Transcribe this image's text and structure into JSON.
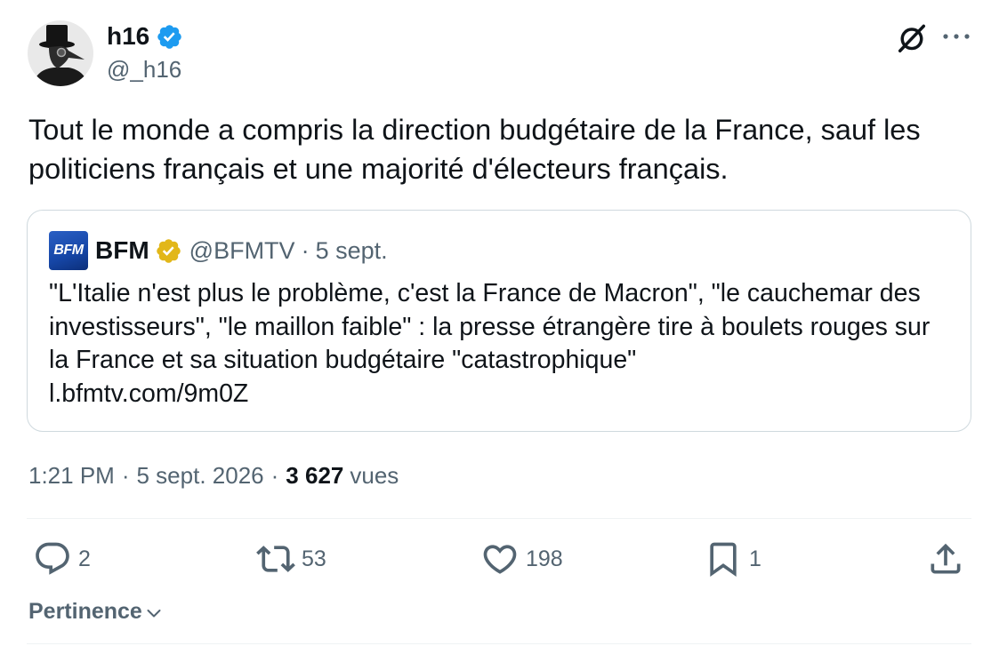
{
  "author": {
    "name": "h16",
    "handle": "@_h16",
    "verified_icon": "verified-badge-icon",
    "avatar_icon": "avatar-image"
  },
  "header_icons": {
    "grok": "grok-icon",
    "more": "more-dots-icon"
  },
  "tweet": {
    "text": "Tout le monde a compris la direction budgétaire de la France, sauf les politiciens français et une majorité d'électeurs français."
  },
  "quote": {
    "logo_text": "BFM",
    "name": "BFM",
    "verified_icon": "gold-verified-badge-icon",
    "handle": "@BFMTV",
    "separator": "·",
    "date": "5 sept.",
    "text": "\"L'Italie n'est plus le problème, c'est la France de Macron\", \"le cauchemar des investisseurs\", \"le maillon faible\" : la presse étrangère tire à boulets rouges sur la France et sa situation budgétaire \"catastrophique\"",
    "link": "l.bfmtv.com/9m0Z"
  },
  "meta": {
    "time": "1:21 PM",
    "separator": "·",
    "date": "5 sept. 2026",
    "views_count": "3 627",
    "views_label": "vues"
  },
  "actions": [
    {
      "icon": "reply-icon",
      "count": "2"
    },
    {
      "icon": "retweet-icon",
      "count": "53"
    },
    {
      "icon": "like-heart-icon",
      "count": "198"
    },
    {
      "icon": "bookmark-icon",
      "count": "1"
    },
    {
      "icon": "share-icon"
    }
  ],
  "sort": {
    "label": "Pertinence",
    "icon": "chevron-down-icon"
  },
  "colors": {
    "text": "#0f1419",
    "secondary": "#536471",
    "verified_blue": "#1d9bf0",
    "verified_gold": "#e2b719",
    "border": "#cfd9de",
    "divider": "#eff3f4",
    "bfm_blue": "#1646a6"
  }
}
